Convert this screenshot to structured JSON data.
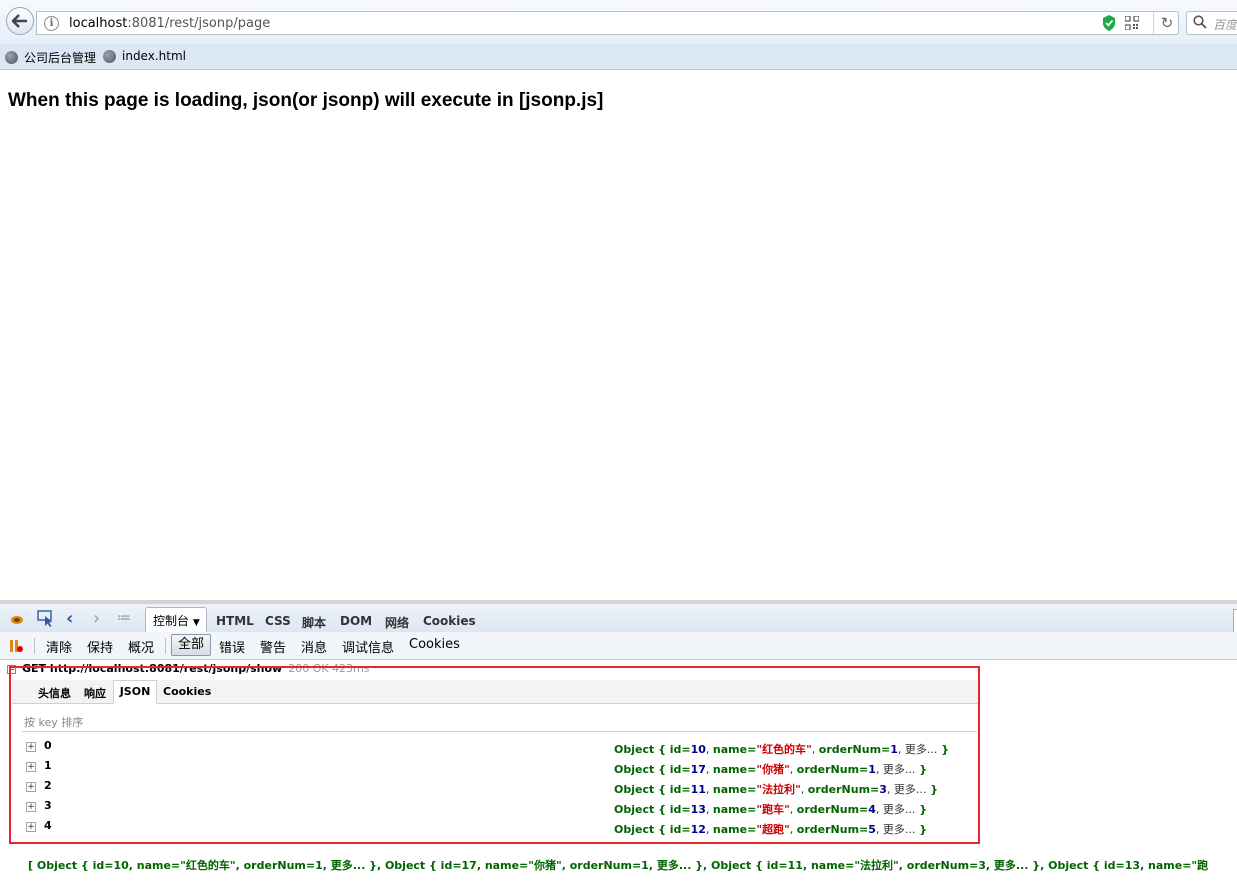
{
  "browser": {
    "url_host": "localhost",
    "url_rest": ":8081/rest/jsonp/page",
    "search_placeholder": "百度"
  },
  "bookmarks": [
    {
      "label": "公司后台管理"
    },
    {
      "label": "index.html"
    }
  ],
  "page": {
    "heading": "When this page is loading, json(or jsonp) will execute in [jsonp.js]"
  },
  "firebug": {
    "tabs": {
      "console": "控制台",
      "html": "HTML",
      "css": "CSS",
      "script": "脚本",
      "dom": "DOM",
      "net": "网络",
      "cookies": "Cookies"
    },
    "toolbar": {
      "clear": "清除",
      "persist": "保持",
      "profile": "概况",
      "all": "全部",
      "errors": "错误",
      "warnings": "警告",
      "info": "消息",
      "debug": "调试信息",
      "cookies": "Cookies"
    },
    "request": {
      "method_url": "GET http://localhost:8081/rest/jsonp/show",
      "status": "200 OK 423ms",
      "sub_tabs": {
        "headers": "头信息",
        "response": "响应",
        "json": "JSON",
        "cookies": "Cookies"
      },
      "sort_label": "按 key 排序",
      "rows": [
        {
          "key": "0",
          "id": "10",
          "name": "红色的车",
          "orderNum": "1"
        },
        {
          "key": "1",
          "id": "17",
          "name": "你猪",
          "orderNum": "1"
        },
        {
          "key": "2",
          "id": "11",
          "name": "法拉利",
          "orderNum": "3"
        },
        {
          "key": "3",
          "id": "13",
          "name": "跑车",
          "orderNum": "4"
        },
        {
          "key": "4",
          "id": "12",
          "name": "超跑",
          "orderNum": "5"
        }
      ],
      "more_label": "更多..."
    },
    "console_output": "[ Object { id=10, name=\"红色的车\", orderNum=1, 更多... }, Object { id=17, name=\"你猪\", orderNum=1, 更多... }, Object { id=11, name=\"法拉利\", orderNum=3, 更多... }, Object { id=13, name=\"跑"
  }
}
